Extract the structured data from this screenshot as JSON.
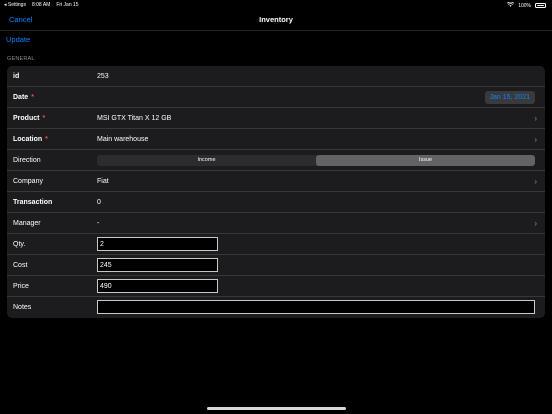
{
  "status": {
    "back_app": "◂ Settings",
    "time": "8:08 AM",
    "date": "Fri Jan 15",
    "wifi_icon": "wifi-icon",
    "battery": "100%"
  },
  "nav": {
    "cancel": "Cancel",
    "title": "Inventory"
  },
  "toolbar": {
    "update": "Update"
  },
  "section": {
    "general": "GENERAL"
  },
  "form": {
    "id": {
      "label": "id",
      "value": "253"
    },
    "date": {
      "label": "Date",
      "required": "*",
      "value": "Jan 15, 2021"
    },
    "product": {
      "label": "Product",
      "required": "*",
      "value": "MSI GTX Titan X 12 GB"
    },
    "location": {
      "label": "Location",
      "required": "*",
      "value": "Main warehouse"
    },
    "direction": {
      "label": "Direction",
      "options": [
        "Income",
        "Issue"
      ],
      "selected": "Issue"
    },
    "company": {
      "label": "Company",
      "value": "Fiat"
    },
    "transaction": {
      "label": "Transaction",
      "value": "0"
    },
    "manager": {
      "label": "Manager",
      "value": "-"
    },
    "qty": {
      "label": "Qty.",
      "value": "2"
    },
    "cost": {
      "label": "Cost",
      "value": "245"
    },
    "price": {
      "label": "Price",
      "value": "490"
    },
    "notes": {
      "label": "Notes",
      "value": ""
    }
  },
  "colors": {
    "accent": "#0a84ff",
    "required": "#ff453a",
    "card": "#1c1c1e",
    "background": "#000000"
  }
}
